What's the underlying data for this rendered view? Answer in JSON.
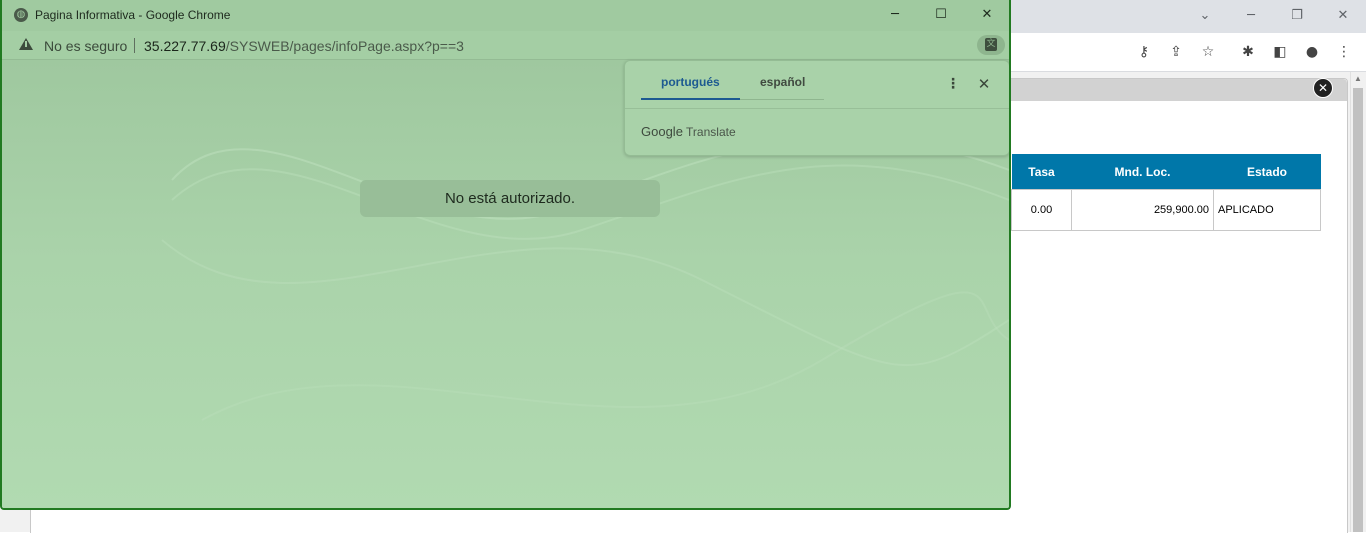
{
  "background_window": {
    "table": {
      "headers": [
        "Tasa",
        "Mnd. Loc.",
        "Estado"
      ],
      "rows": [
        [
          "0.00",
          "259,900.00",
          "APLICADO"
        ]
      ]
    }
  },
  "popup": {
    "title": "Pagina Informativa - Google Chrome",
    "security_label": "No es seguro",
    "url_host": "35.227.77.69",
    "url_path": "/SYSWEB/pages/infoPage.aspx?p==3",
    "message": "No está autorizado.",
    "background_color": "#aed7ae",
    "frame_color": "#217a21"
  },
  "translate_bubble": {
    "tabs": [
      "portugués",
      "español"
    ],
    "active_tab": "portugués",
    "brand_google": "Google",
    "brand_translate": "Translate"
  },
  "icons": {
    "window_minimize": "─",
    "window_maximize": "☐",
    "window_close": "✕",
    "menu_dots": "⋮",
    "restore": "❐",
    "chevron_down": "⌄"
  }
}
